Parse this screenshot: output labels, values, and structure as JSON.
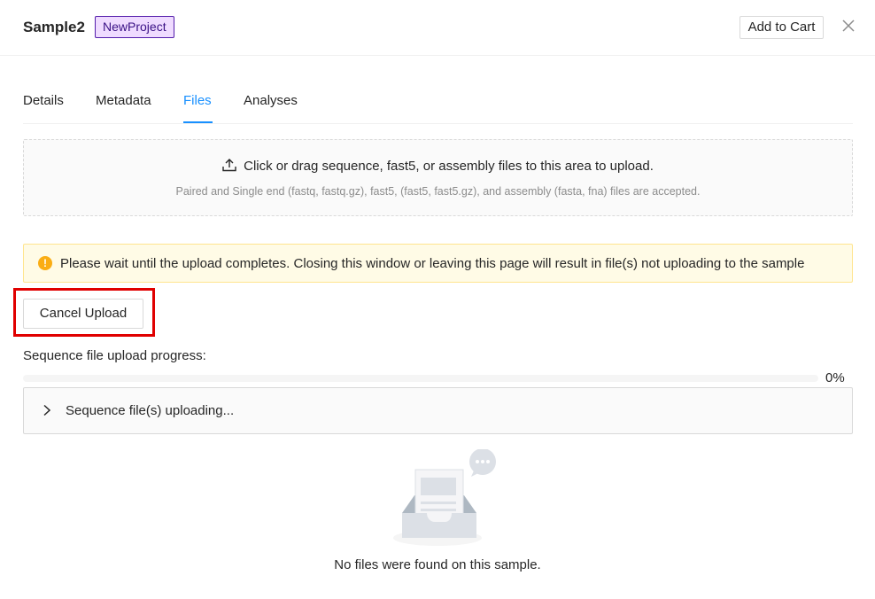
{
  "header": {
    "title": "Sample2",
    "project_tag": "NewProject",
    "add_to_cart_label": "Add to Cart",
    "close_icon": "close-icon"
  },
  "tabs": [
    {
      "label": "Details",
      "active": false
    },
    {
      "label": "Metadata",
      "active": false
    },
    {
      "label": "Files",
      "active": true
    },
    {
      "label": "Analyses",
      "active": false
    }
  ],
  "upload": {
    "icon": "upload-icon",
    "main_text": "Click or drag sequence, fast5, or assembly files to this area to upload.",
    "hint_text": "Paired and Single end (fastq, fastq.gz), fast5, (fast5, fast5.gz), and assembly (fasta, fna) files are accepted."
  },
  "alert": {
    "icon": "exclamation-circle-icon",
    "message": "Please wait until the upload completes. Closing this window or leaving this page will result in file(s) not uploading to the sample"
  },
  "cancel_upload_label": "Cancel Upload",
  "progress": {
    "label": "Sequence file upload progress:",
    "percent": 0,
    "percent_text": "0%"
  },
  "collapse": {
    "arrow_icon": "chevron-right-icon",
    "label": "Sequence file(s) uploading..."
  },
  "empty": {
    "icon": "empty-inbox-icon",
    "text": "No files were found on this sample."
  },
  "colors": {
    "accent": "#1890ff",
    "tag_bg": "#efdbff",
    "tag_border": "#531dab",
    "warning": "#faad14",
    "highlight": "#e00000"
  }
}
